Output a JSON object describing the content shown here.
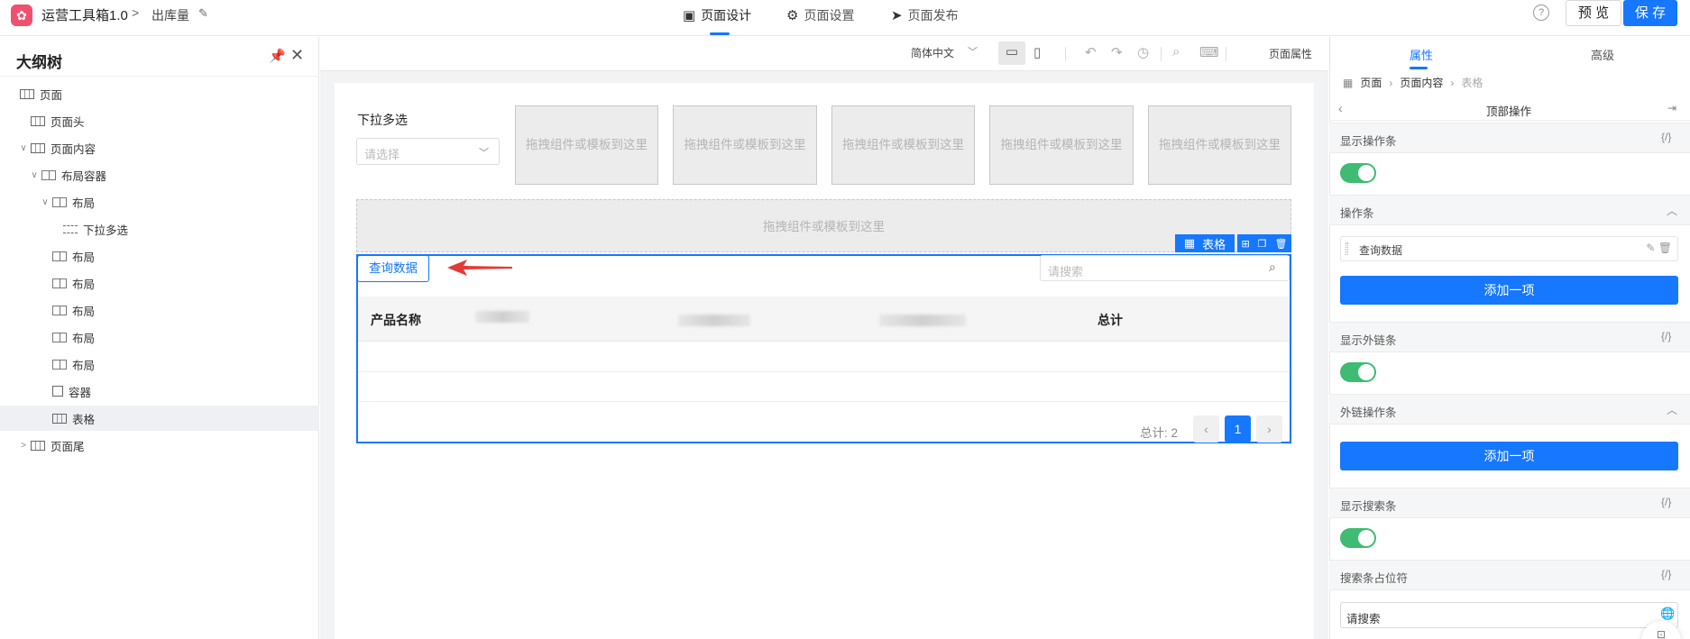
{
  "header": {
    "app_title": "运营工具箱1.0",
    "breadcrumb_sep": ">",
    "page_name": "出库量",
    "tabs": [
      {
        "label": "页面设计",
        "icon": "layout-icon"
      },
      {
        "label": "页面设置",
        "icon": "gear-icon"
      },
      {
        "label": "页面发布",
        "icon": "send-icon"
      }
    ],
    "help": "?",
    "preview_label": "预 览",
    "save_label": "保 存"
  },
  "outline": {
    "title": "大纲树",
    "items": [
      {
        "label": "页面",
        "icon": "grid-icon",
        "level": 0,
        "arrow": ""
      },
      {
        "label": "页面头",
        "icon": "grid-icon",
        "level": 1,
        "arrow": ""
      },
      {
        "label": "页面内容",
        "icon": "grid-icon",
        "level": 1,
        "arrow": "∨"
      },
      {
        "label": "布局容器",
        "icon": "columns-icon",
        "level": 2,
        "arrow": "∨"
      },
      {
        "label": "布局",
        "icon": "columns-icon",
        "level": 3,
        "arrow": "∨"
      },
      {
        "label": "下拉多选",
        "icon": "list-icon",
        "level": 4,
        "arrow": ""
      },
      {
        "label": "布局",
        "icon": "columns-icon",
        "level": 3,
        "arrow": ""
      },
      {
        "label": "布局",
        "icon": "columns-icon",
        "level": 3,
        "arrow": ""
      },
      {
        "label": "布局",
        "icon": "columns-icon",
        "level": 3,
        "arrow": ""
      },
      {
        "label": "布局",
        "icon": "columns-icon",
        "level": 3,
        "arrow": ""
      },
      {
        "label": "布局",
        "icon": "columns-icon",
        "level": 3,
        "arrow": ""
      },
      {
        "label": "容器",
        "icon": "box-icon",
        "level": 3,
        "arrow": ""
      },
      {
        "label": "表格",
        "icon": "grid-icon",
        "level": 3,
        "arrow": "",
        "selected": true
      },
      {
        "label": "页面尾",
        "icon": "grid-icon",
        "level": 1,
        "arrow": ">"
      }
    ]
  },
  "toolbar": {
    "language": "简体中文",
    "page_attr": "页面属性"
  },
  "canvas": {
    "dropdown_label": "下拉多选",
    "dropdown_placeholder": "请选择",
    "drop_hint": "拖拽组件或模板到这里",
    "table_tag": "表格",
    "query_button": "查询数据",
    "search_placeholder": "请搜索",
    "columns": [
      "产品名称",
      "总计"
    ],
    "total_text": "总计: 2",
    "current_page": "1"
  },
  "props": {
    "tabs": [
      "属性",
      "高级"
    ],
    "crumbs": [
      "页面",
      "页面内容",
      "表格"
    ],
    "sub_title": "顶部操作",
    "sections": {
      "show_ops": "显示操作条",
      "ops": "操作条",
      "show_link": "显示外链条",
      "link_ops": "外链操作条",
      "show_search": "显示搜索条",
      "search_placeholder_label": "搜索条占位符"
    },
    "expr_icon": "{/}",
    "op_item": "查询数据",
    "add_item": "添加一项",
    "search_placeholder_value": "请搜索"
  },
  "colors": {
    "primary": "#1677ff",
    "toggle_on": "#3fbb73",
    "arrow": "#e53935",
    "logo": "#f0506e"
  }
}
